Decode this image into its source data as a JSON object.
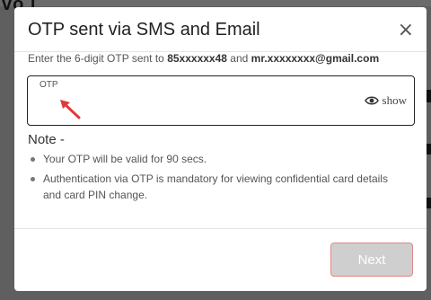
{
  "backdrop": {
    "text": "vo i"
  },
  "modal": {
    "title": "OTP sent via SMS and Email",
    "close_symbol": "×",
    "subtitle_prefix": "Enter the 6-digit OTP sent to ",
    "phone": "85xxxxxx48",
    "subtitle_mid": " and ",
    "email": "mr.xxxxxxxx@gmail.com"
  },
  "otp_field": {
    "label": "OTP",
    "value": "",
    "show_label": "show",
    "show_icon": "eye-icon"
  },
  "notes": {
    "heading": "Note -",
    "items": [
      "Your OTP will be valid for 90 secs.",
      "Authentication via OTP is mandatory for viewing confidential card details and card PIN change."
    ]
  },
  "footer": {
    "next_label": "Next"
  },
  "colors": {
    "overlay": "#5f5f5f",
    "modal_bg": "#ffffff",
    "field_border": "#222222",
    "arrow": "#e03b3b",
    "button_bg": "#cfcfcf",
    "button_border": "#e08a8a"
  }
}
